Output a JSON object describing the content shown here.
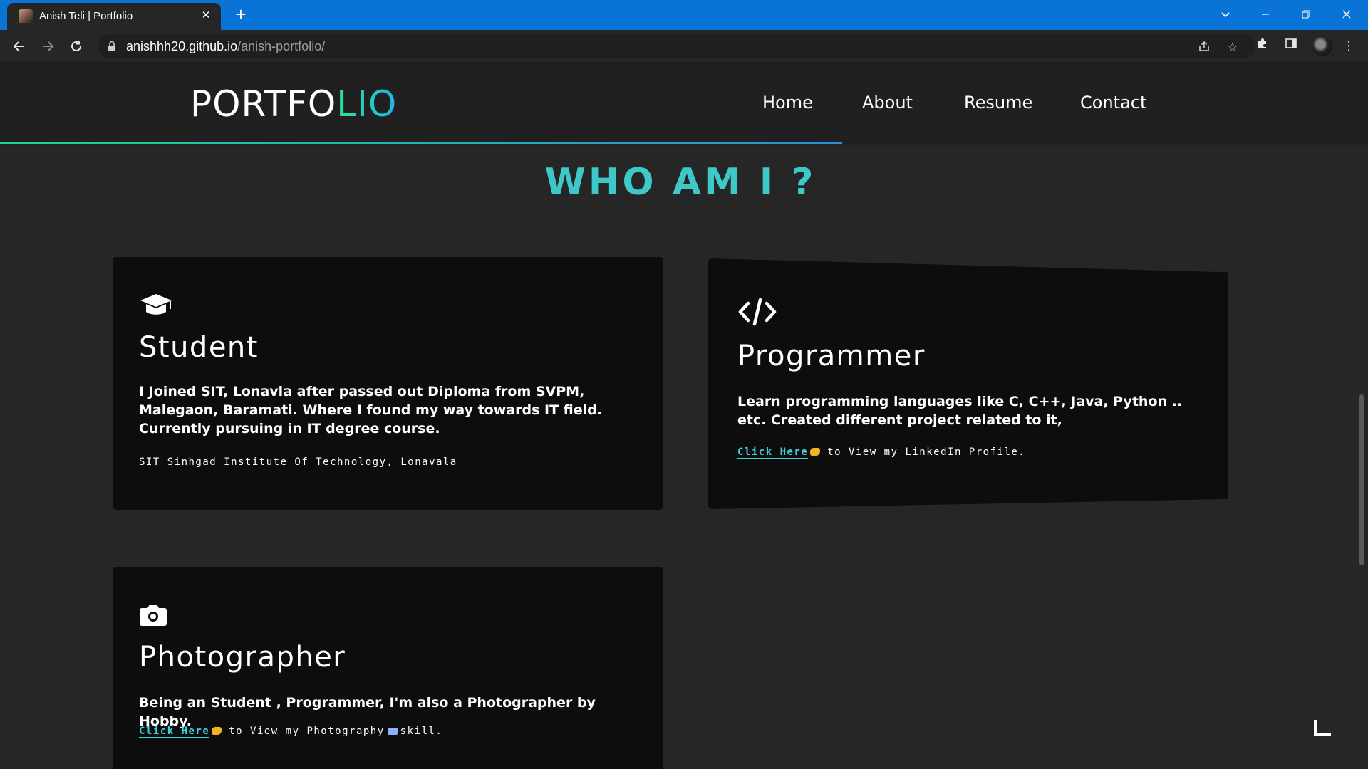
{
  "browser": {
    "tab_title": "Anish Teli | Portfolio",
    "tab_close_icon": "close-icon",
    "new_tab_icon": "plus-icon",
    "url_host": "anishhh20.github.io",
    "url_path": "/anish-portfolio/",
    "accent_color": "#0a74d6"
  },
  "header": {
    "logo_main": "PORTFO",
    "logo_accent": "LIO",
    "nav": [
      "Home",
      "About",
      "Resume",
      "Contact"
    ]
  },
  "section_title": "WHO AM I ?",
  "cards": {
    "student": {
      "icon": "graduation-cap-icon",
      "title": "Student",
      "desc": "I Joined SIT, Lonavla after passed out Diploma from SVPM, Malegaon, Baramati. Where I found my way towards IT field. Currently pursuing in IT degree course.",
      "note": "SIT Sinhgad Institute Of Technology, Lonavala"
    },
    "programmer": {
      "icon": "code-icon",
      "title": "Programmer",
      "desc": "Learn programming languages like C, C++, Java, Python .. etc. Created different project related to it,",
      "link": "Click Here",
      "link_suffix": "to View my LinkedIn Profile."
    },
    "photographer": {
      "icon": "camera-icon",
      "title": "Photographer",
      "desc": "Being an Student , Programmer, I'm also a Photographer by Hobby.",
      "link": "Click Here",
      "link_suffix_a": "to View my Photography",
      "link_suffix_b": "skill."
    }
  }
}
